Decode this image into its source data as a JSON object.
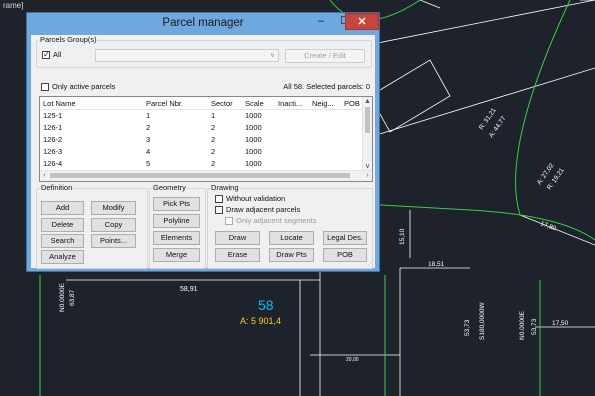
{
  "cad": {
    "tab_label": "rame]",
    "colors": {
      "background": "#1d222b",
      "lines": "#ffffff",
      "boundary": "#3ad13f",
      "parcel_label": "#00bfff",
      "area_label": "#ffd21f"
    },
    "labels": [
      {
        "text": "58,91",
        "note": "segment-length"
      },
      {
        "text": "58",
        "note": "parcel-number"
      },
      {
        "text": "A: 5 901,4",
        "note": "parcel-area"
      },
      {
        "text": "N0.0000E",
        "note": "bearing"
      },
      {
        "text": "63,87",
        "note": "segment-length"
      },
      {
        "text": "18,51",
        "note": "segment-length"
      },
      {
        "text": "15,10",
        "note": "segment-length"
      },
      {
        "text": "53,73",
        "note": "segment-length"
      },
      {
        "text": "S180,0000W",
        "note": "bearing"
      },
      {
        "text": "N0.0000E",
        "note": "bearing"
      },
      {
        "text": "53,73",
        "note": "segment-length"
      },
      {
        "text": "17,50",
        "note": "segment-length"
      },
      {
        "text": "17,80",
        "note": "segment-length"
      },
      {
        "text": "R: 31,21",
        "note": "curve-radius"
      },
      {
        "text": "A: 44,77",
        "note": "curve-arc"
      },
      {
        "text": "A: 27,02",
        "note": "curve-arc"
      },
      {
        "text": "R: 19,21",
        "note": "curve-radius"
      },
      {
        "text": "20,00",
        "note": "segment-length"
      }
    ]
  },
  "window": {
    "title": "Parcel manager",
    "controls": {
      "minimize": "–",
      "maximize": "☐",
      "close": "✕"
    }
  },
  "groups": {
    "label": "Parcels Group(s)",
    "all_checkbox": {
      "label": "All",
      "checked": true
    },
    "combo_value": "",
    "create_edit": "Create / Edit"
  },
  "filter": {
    "only_active": {
      "label": "Only active parcels",
      "checked": false
    },
    "summary": "All 58. Selected parcels: 0"
  },
  "table": {
    "columns": [
      "Lot Name",
      "Parcel Nbr.",
      "Sector",
      "Scale",
      "Inacti...",
      "Neig...",
      "POB"
    ],
    "rows": [
      [
        "125-1",
        "1",
        "1",
        "1000",
        "",
        "",
        ""
      ],
      [
        "126-1",
        "2",
        "2",
        "1000",
        "",
        "",
        ""
      ],
      [
        "126-2",
        "3",
        "2",
        "1000",
        "",
        "",
        ""
      ],
      [
        "126-3",
        "4",
        "2",
        "1000",
        "",
        "",
        ""
      ],
      [
        "126-4",
        "5",
        "2",
        "1000",
        "",
        "",
        ""
      ]
    ]
  },
  "definition": {
    "label": "Definition",
    "add": "Add",
    "modify": "Modify",
    "delete": "Delete",
    "copy": "Copy",
    "search": "Search",
    "points": "Points...",
    "analyze": "Analyze"
  },
  "geometry": {
    "label": "Geometry",
    "pick_pts": "Pick Pts",
    "polyline": "Polyline",
    "elements": "Elements",
    "merge": "Merge"
  },
  "drawing": {
    "label": "Drawing",
    "without_validation": {
      "label": "Without validation",
      "checked": false
    },
    "draw_adjacent_parcels": {
      "label": "Draw adjacent parcels",
      "checked": false
    },
    "only_adjacent_segments": {
      "label": "Only adjacent segments",
      "checked": false,
      "enabled": false
    },
    "draw": "Draw",
    "locate": "Locate",
    "legal_des": "Legal Des.",
    "erase": "Erase",
    "draw_pts": "Draw Pts",
    "pob": "POB"
  }
}
